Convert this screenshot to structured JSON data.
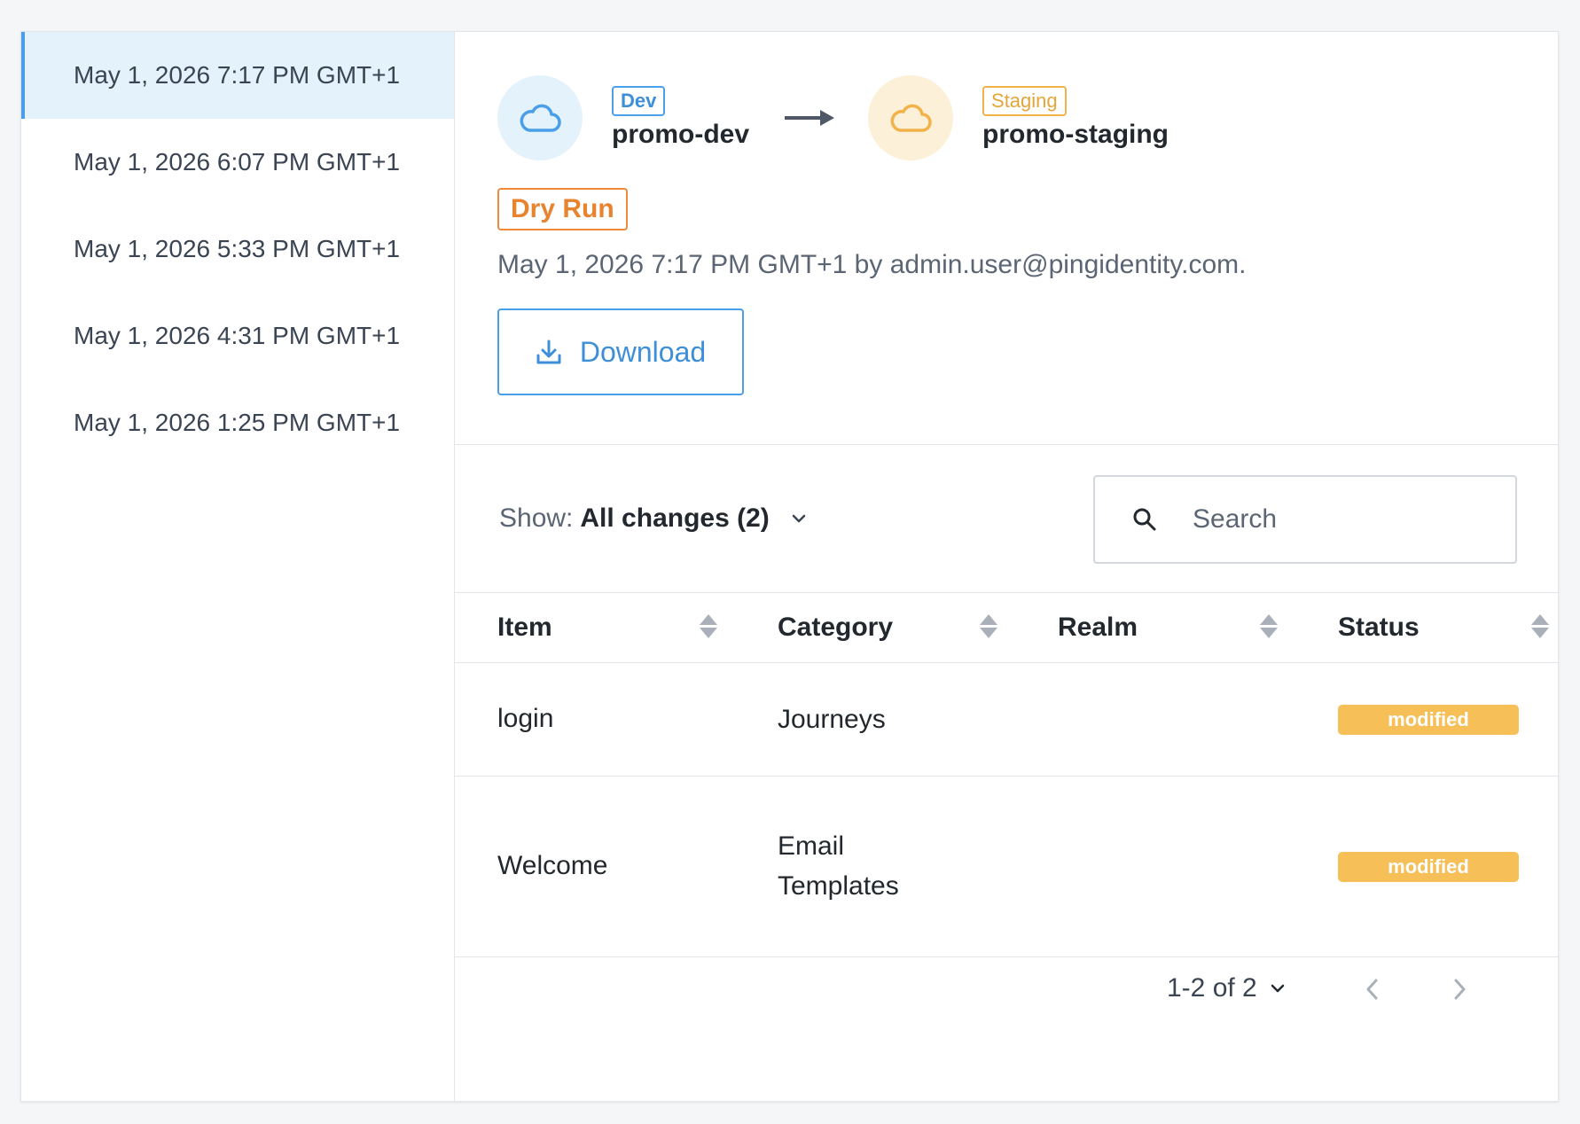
{
  "history": {
    "items": [
      {
        "label": "May 1, 2026 7:17 PM GMT+1",
        "active": true
      },
      {
        "label": "May 1, 2026 6:07 PM GMT+1",
        "active": false
      },
      {
        "label": "May 1, 2026 5:33 PM GMT+1",
        "active": false
      },
      {
        "label": "May 1, 2026 4:31 PM GMT+1",
        "active": false
      },
      {
        "label": "May 1, 2026 1:25 PM GMT+1",
        "active": false
      }
    ]
  },
  "promotion": {
    "source": {
      "badge": "Dev",
      "name": "promo-dev",
      "icon": "cloud-icon",
      "color": "#4a9fe8"
    },
    "target": {
      "badge": "Staging",
      "name": "promo-staging",
      "icon": "cloud-icon",
      "color": "#f1b24a"
    },
    "mode_badge": "Dry Run",
    "meta": "May 1, 2026 7:17 PM GMT+1 by admin.user@pingidentity.com.",
    "download_label": "Download"
  },
  "filter": {
    "show_label": "Show:",
    "show_value": "All changes (2)",
    "search_placeholder": "Search"
  },
  "table": {
    "columns": [
      "Item",
      "Category",
      "Realm",
      "Status"
    ],
    "rows": [
      {
        "item": "login",
        "category": "Journeys",
        "realm": "",
        "status": "modified"
      },
      {
        "item": "Welcome",
        "category": "Email Templates",
        "realm": "",
        "status": "modified"
      }
    ]
  },
  "pagination": {
    "range": "1-2 of 2"
  },
  "colors": {
    "accent": "#4a9fe8",
    "dry_run": "#ef8a3a",
    "status_modified": "#f6bf57"
  }
}
